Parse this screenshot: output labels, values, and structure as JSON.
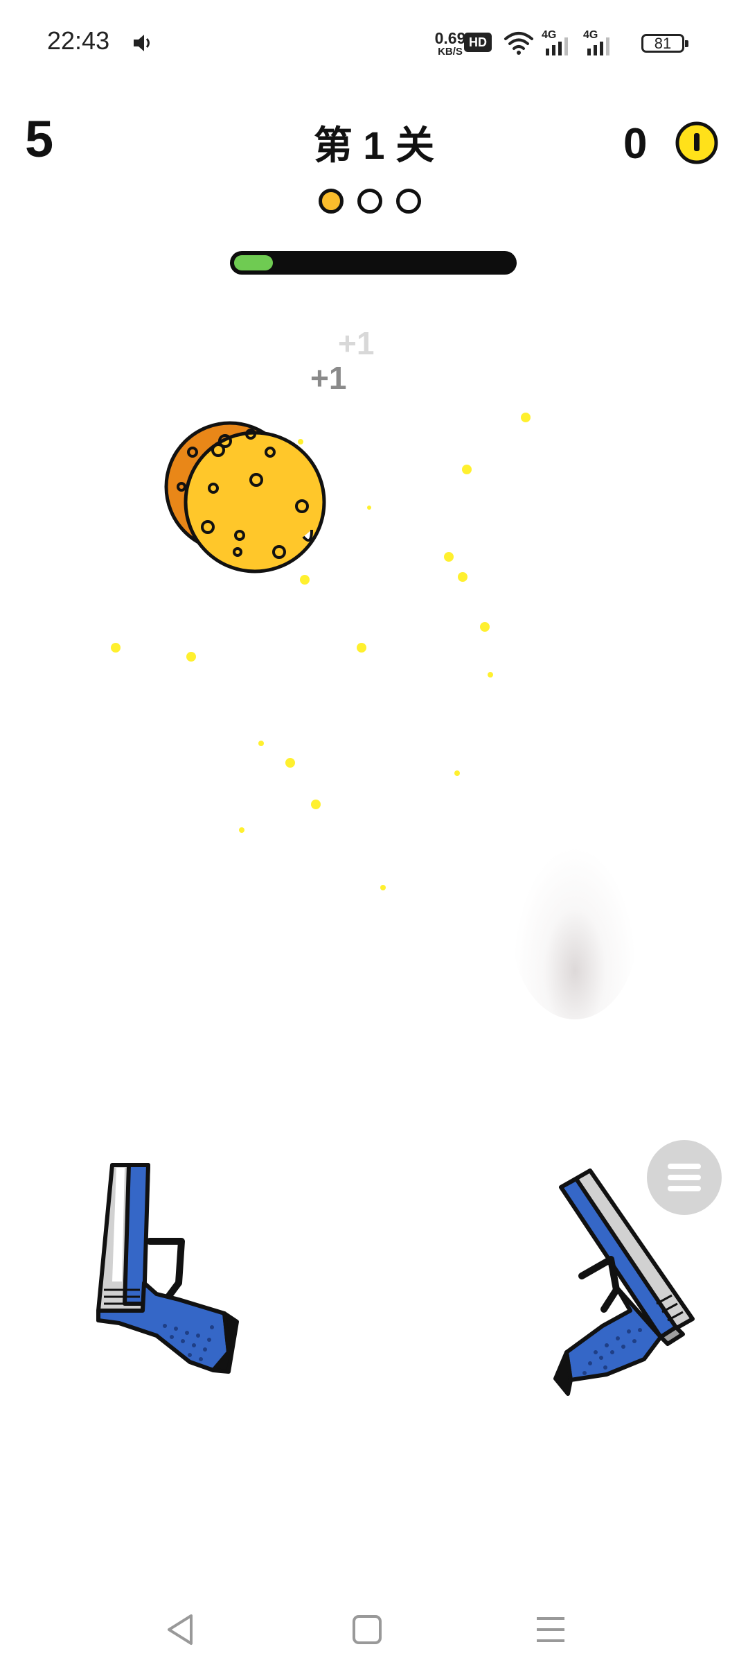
{
  "status_bar": {
    "time": "22:43",
    "net_speed_value": "0.69",
    "net_speed_unit": "KB/S",
    "hd_label": "HD",
    "signal_labels": [
      "4G",
      "4G"
    ],
    "battery": "81",
    "icons": [
      "volume-icon",
      "hd-icon",
      "wifi-icon",
      "signal-icon",
      "signal-icon",
      "battery-icon"
    ]
  },
  "hud": {
    "score": "5",
    "level_title": "第 1 关",
    "coin_count": "0",
    "stages": [
      "current",
      "pending",
      "pending"
    ],
    "progress": 0.14
  },
  "scene": {
    "popups": [
      "+1",
      "+1"
    ],
    "target": "cookie-target",
    "weapons": [
      "left-pistol",
      "right-pistol"
    ],
    "menu_icon": "menu-icon"
  },
  "nav_bar": {
    "buttons": [
      "back-icon",
      "home-icon",
      "recents-icon"
    ]
  },
  "colors": {
    "coin": "#ffe11a",
    "cookie": "#ffc72a",
    "cookie_back": "#e98718",
    "progress_fill": "#6fcb52",
    "stage_active": "#fbbd2c",
    "gun_blue": "#3567c7",
    "gun_silver": "#c3c3c3",
    "sparkle": "#fff02e"
  }
}
